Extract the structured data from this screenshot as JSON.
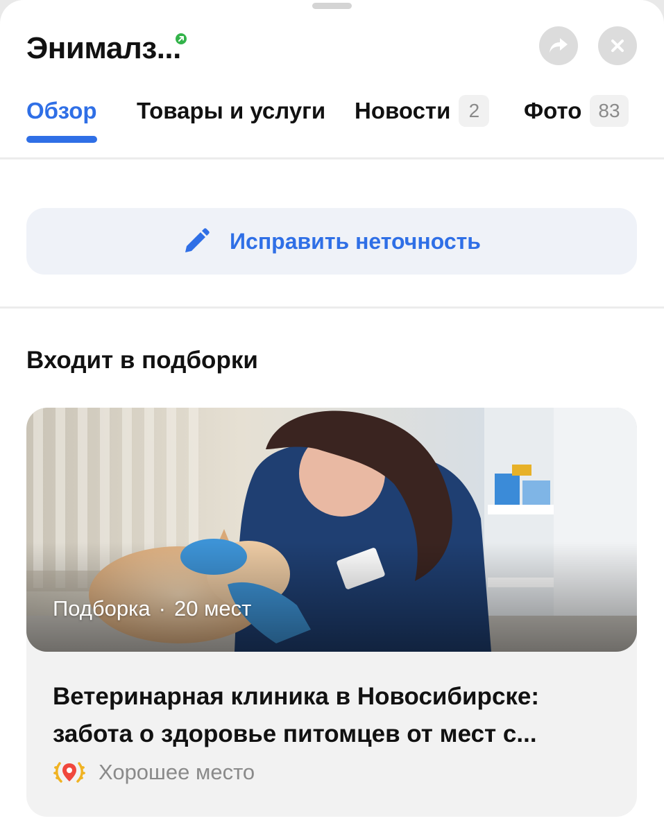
{
  "header": {
    "title": "Энималз...",
    "share_icon": "share-icon",
    "close_icon": "close-icon"
  },
  "tabs": [
    {
      "label": "Обзор",
      "active": true
    },
    {
      "label": "Товары и услуги"
    },
    {
      "label": "Новости",
      "count": "2"
    },
    {
      "label": "Фото",
      "count": "83"
    }
  ],
  "actions": {
    "fix_label": "Исправить неточность",
    "fix_icon": "pencil-icon"
  },
  "collections": {
    "title": "Входит в подборки",
    "card": {
      "type_label": "Подборка",
      "places": "20 мест",
      "title_line1": "Ветеринарная клиника в Новосибирске:",
      "title_line2": "забота о здоровье питомцев от мест с...",
      "badge": "Хорошее место",
      "badge_icon": "good-place-laurel-icon"
    }
  },
  "colors": {
    "accent": "#2f6fe6",
    "verified": "#33b34a",
    "muted": "#8a8a8a"
  }
}
